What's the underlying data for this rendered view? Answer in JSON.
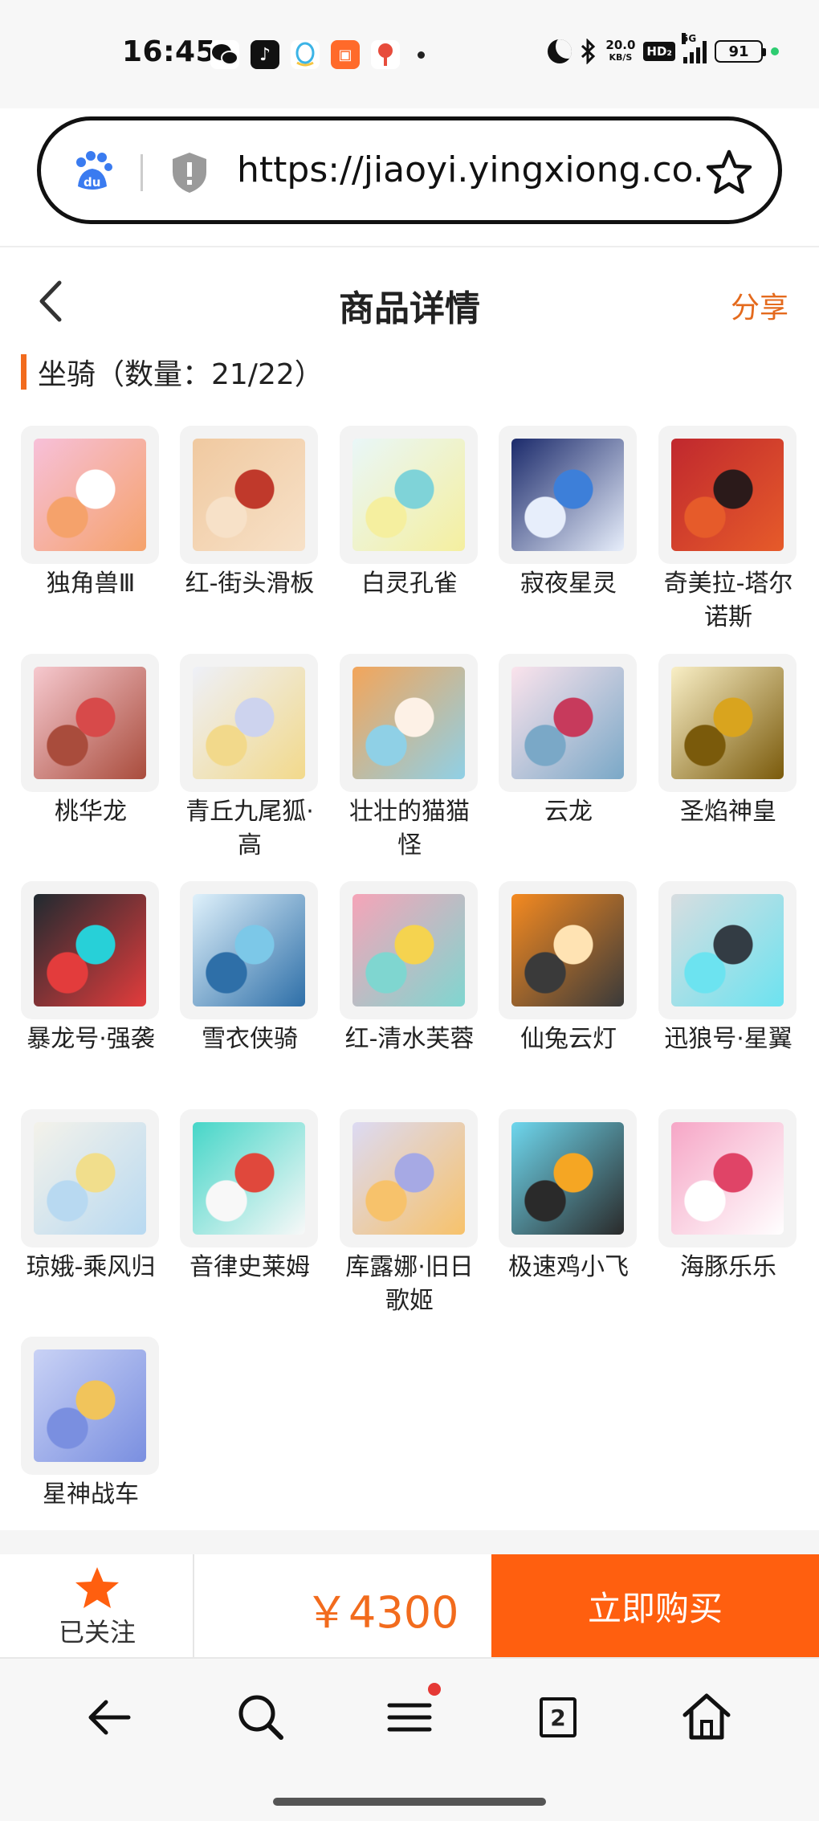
{
  "status_bar": {
    "time": "16:45",
    "net_speed_value": "20.0",
    "net_speed_unit": "KB/S",
    "hd_badge": "HD₂",
    "network": "5G",
    "battery": "91"
  },
  "url_bar": {
    "url": "https://jiaoyi.yingxiong.co..."
  },
  "header": {
    "title": "商品详情",
    "share": "分享"
  },
  "section": {
    "title": "坐骑（数量：21/22）"
  },
  "items": [
    {
      "name": "独角兽Ⅲ",
      "colors": [
        "#f7c0d9",
        "#ffffff",
        "#f5a26b"
      ]
    },
    {
      "name": "红-街头滑板",
      "colors": [
        "#f0c9a0",
        "#c0392b",
        "#f7e1c8"
      ]
    },
    {
      "name": "白灵孔雀",
      "colors": [
        "#e9f7f8",
        "#7fd3d8",
        "#f5ef9f"
      ]
    },
    {
      "name": "寂夜星灵",
      "colors": [
        "#1b2a6b",
        "#3d7fd9",
        "#e7eefb"
      ]
    },
    {
      "name": "奇美拉-塔尔诺斯",
      "colors": [
        "#c0282e",
        "#2b1a1a",
        "#e65b2a"
      ]
    },
    {
      "name": "桃华龙",
      "colors": [
        "#f6c9cf",
        "#d74a4a",
        "#a94c3c"
      ]
    },
    {
      "name": "青丘九尾狐·高",
      "colors": [
        "#eef0f8",
        "#cdd3ee",
        "#f2d98b"
      ]
    },
    {
      "name": "壮壮的猫猫怪",
      "colors": [
        "#f3a55a",
        "#fdf1e6",
        "#8fd0e6"
      ]
    },
    {
      "name": "云龙",
      "colors": [
        "#fbe3ec",
        "#c73a5c",
        "#7aa8c7"
      ]
    },
    {
      "name": "圣焰神皇",
      "colors": [
        "#f9efc6",
        "#d9a41e",
        "#7a5a0b"
      ]
    },
    {
      "name": "暴龙号·强袭",
      "colors": [
        "#1f2a30",
        "#27d0d8",
        "#e33c3c"
      ]
    },
    {
      "name": "雪衣侠骑",
      "colors": [
        "#dff1fb",
        "#7cc8e8",
        "#2e6fa8"
      ]
    },
    {
      "name": "红-清水芙蓉",
      "colors": [
        "#f6a4b8",
        "#f5d34f",
        "#7fd6d0"
      ]
    },
    {
      "name": "仙兔云灯",
      "colors": [
        "#f58a20",
        "#ffe3b3",
        "#3a3a3a"
      ]
    },
    {
      "name": "迅狼号·星翼",
      "colors": [
        "#d8dde0",
        "#333c44",
        "#6ce3f0"
      ]
    },
    {
      "name": "琼娥-乘风归",
      "colors": [
        "#f4f2ea",
        "#f1de8c",
        "#b8d9f1"
      ]
    },
    {
      "name": "音律史莱姆",
      "colors": [
        "#46d6c8",
        "#e0483c",
        "#f8f8f8"
      ]
    },
    {
      "name": "库露娜·旧日歌姬",
      "colors": [
        "#dcdaf3",
        "#a6a9e4",
        "#f7c26b"
      ]
    },
    {
      "name": "极速鸡小飞",
      "colors": [
        "#6ed7ee",
        "#f5a623",
        "#2a2a2a"
      ]
    },
    {
      "name": "海豚乐乐",
      "colors": [
        "#f6a6c6",
        "#e04467",
        "#ffffff"
      ]
    },
    {
      "name": "星神战车",
      "colors": [
        "#c9d2f5",
        "#f1c45b",
        "#7a8fe0"
      ]
    }
  ],
  "buy_bar": {
    "follow_label": "已关注",
    "price": "￥4300",
    "buy_label": "立即购买"
  },
  "browser_nav": {
    "tab_count": "2"
  },
  "theme": {
    "accent": "#ff5f0f",
    "price_color": "#f26b1d"
  }
}
